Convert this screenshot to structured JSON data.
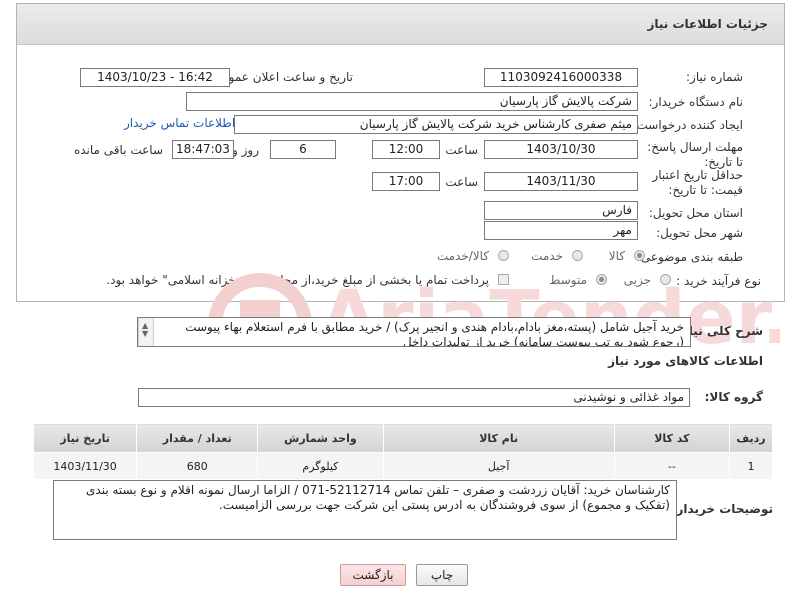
{
  "header": {
    "title": "جزئیات اطلاعات نیاز"
  },
  "form": {
    "need_number_label": "شماره نیاز:",
    "need_number": "1103092416000338",
    "announce_label": "تاریخ و ساعت اعلان عمومی:",
    "announce_value": "1403/10/23 - 16:42",
    "buyer_org_label": "نام دستگاه خریدار:",
    "buyer_org": "شرکت پالایش گاز پارسیان",
    "requester_label": "ایجاد کننده درخواست:",
    "requester": "میثم صفری کارشناس خرید شرکت پالایش گاز پارسیان",
    "contact_link": "اطلاعات تماس خریدار",
    "deadline_label": "مهلت ارسال پاسخ: تا تاریخ:",
    "deadline_date": "1403/10/30",
    "time_label": "ساعت",
    "deadline_time": "12:00",
    "days_value": "6",
    "days_label": "روز و",
    "remaining_time": "18:47:03",
    "remaining_label": "ساعت باقی مانده",
    "min_validity_label": "حداقل تاریخ اعتبار قیمت: تا تاریخ:",
    "validity_date": "1403/11/30",
    "validity_time": "17:00",
    "province_label": "استان محل تحویل:",
    "province": "فارس",
    "city_label": "شهر محل تحویل:",
    "city": "مهر",
    "category_label": "طبقه بندی موضوعی:",
    "category_options": [
      "کالا",
      "خدمت",
      "کالا/خدمت"
    ],
    "process_label": "نوع فرآیند خرید :",
    "process_options": [
      "جزیی",
      "متوسط"
    ],
    "payment_note": "پرداخت تمام یا بخشی از مبلغ خرید،از محل \"اسناد خزانه اسلامی\" خواهد بود."
  },
  "description": {
    "label": "شرح کلی نیاز:",
    "line1": "خرید آجیل شامل (پسته،مغز بادام،بادام هندی و انجیر پرک) / خرید مطابق با فرم استعلام بهاء پیوست",
    "line2": "(رجوع شود به تب پیوست سامانه)  خرید از تولیدات داخل"
  },
  "goods_info": {
    "title": "اطلاعات کالاهای مورد نیاز",
    "group_label": "گروه کالا:",
    "group_value": "مواد غذائی و نوشیدنی"
  },
  "table": {
    "headers": [
      "ردیف",
      "کد کالا",
      "نام کالا",
      "واحد شمارش",
      "تعداد / مقدار",
      "تاریخ نیاز"
    ],
    "rows": [
      [
        "1",
        "--",
        "آجیل",
        "کیلوگرم",
        "680",
        "1403/11/30"
      ]
    ]
  },
  "buyer_notes": {
    "label": "توضیحات خریدار:",
    "text": "کارشناسان خرید: آقایان زردشت و صفری – تلفن تماس 52112714-071 / الزاما ارسال نمونه اقلام و نوع بسته بندی (تفکیک و مجموع) از سوی فروشندگان به ادرس پستی این شرکت جهت بررسی الزامیست."
  },
  "buttons": {
    "print": "چاپ",
    "back": "بازگشت"
  },
  "watermark": {
    "text": "AriaTender.neT"
  },
  "colors": {
    "link": "#1f5cb3",
    "watermark": "#f3d0d0"
  }
}
